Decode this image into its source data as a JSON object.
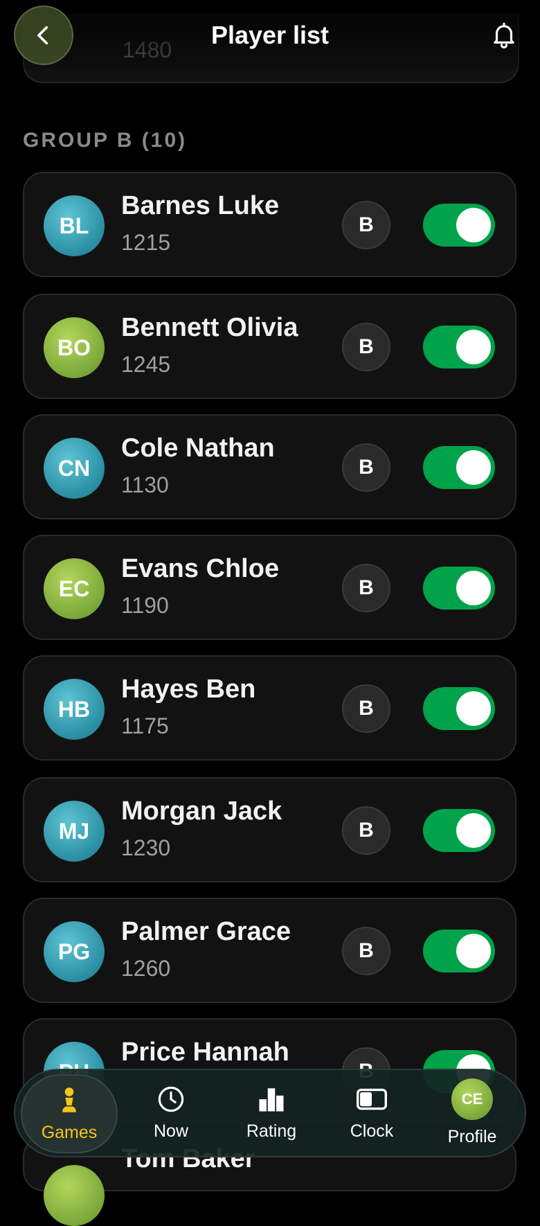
{
  "header": {
    "title": "Player list"
  },
  "previous_card": {
    "rating": "1480"
  },
  "group": {
    "label": "GROUP B (10)"
  },
  "players": [
    {
      "initials": "BL",
      "name": "Barnes Luke",
      "rating": "1215",
      "group": "B",
      "avatar_color": "teal",
      "enabled": true
    },
    {
      "initials": "BO",
      "name": "Bennett Olivia",
      "rating": "1245",
      "group": "B",
      "avatar_color": "green",
      "enabled": true
    },
    {
      "initials": "CN",
      "name": "Cole Nathan",
      "rating": "1130",
      "group": "B",
      "avatar_color": "teal",
      "enabled": true
    },
    {
      "initials": "EC",
      "name": "Evans Chloe",
      "rating": "1190",
      "group": "B",
      "avatar_color": "green",
      "enabled": true
    },
    {
      "initials": "HB",
      "name": "Hayes Ben",
      "rating": "1175",
      "group": "B",
      "avatar_color": "teal",
      "enabled": true
    },
    {
      "initials": "MJ",
      "name": "Morgan Jack",
      "rating": "1230",
      "group": "B",
      "avatar_color": "teal",
      "enabled": true
    },
    {
      "initials": "PG",
      "name": "Palmer Grace",
      "rating": "1260",
      "group": "B",
      "avatar_color": "teal",
      "enabled": true
    },
    {
      "initials": "PH",
      "name": "Price Hannah",
      "rating": "",
      "group": "B",
      "avatar_color": "teal",
      "enabled": true
    }
  ],
  "partial_bottom_player": {
    "name": "Tom Baker"
  },
  "nav": {
    "items": [
      {
        "label": "Games",
        "icon": "pawn-icon",
        "active": true
      },
      {
        "label": "Now",
        "icon": "clock-icon",
        "active": false
      },
      {
        "label": "Rating",
        "icon": "bar-chart-icon",
        "active": false
      },
      {
        "label": "Clock",
        "icon": "chess-clock-icon",
        "active": false
      },
      {
        "label": "Profile",
        "icon": "avatar",
        "active": false,
        "initials": "CE"
      }
    ]
  },
  "colors": {
    "toggle_on": "#00a34a",
    "active_nav": "#f5c518",
    "background": "#000000"
  }
}
